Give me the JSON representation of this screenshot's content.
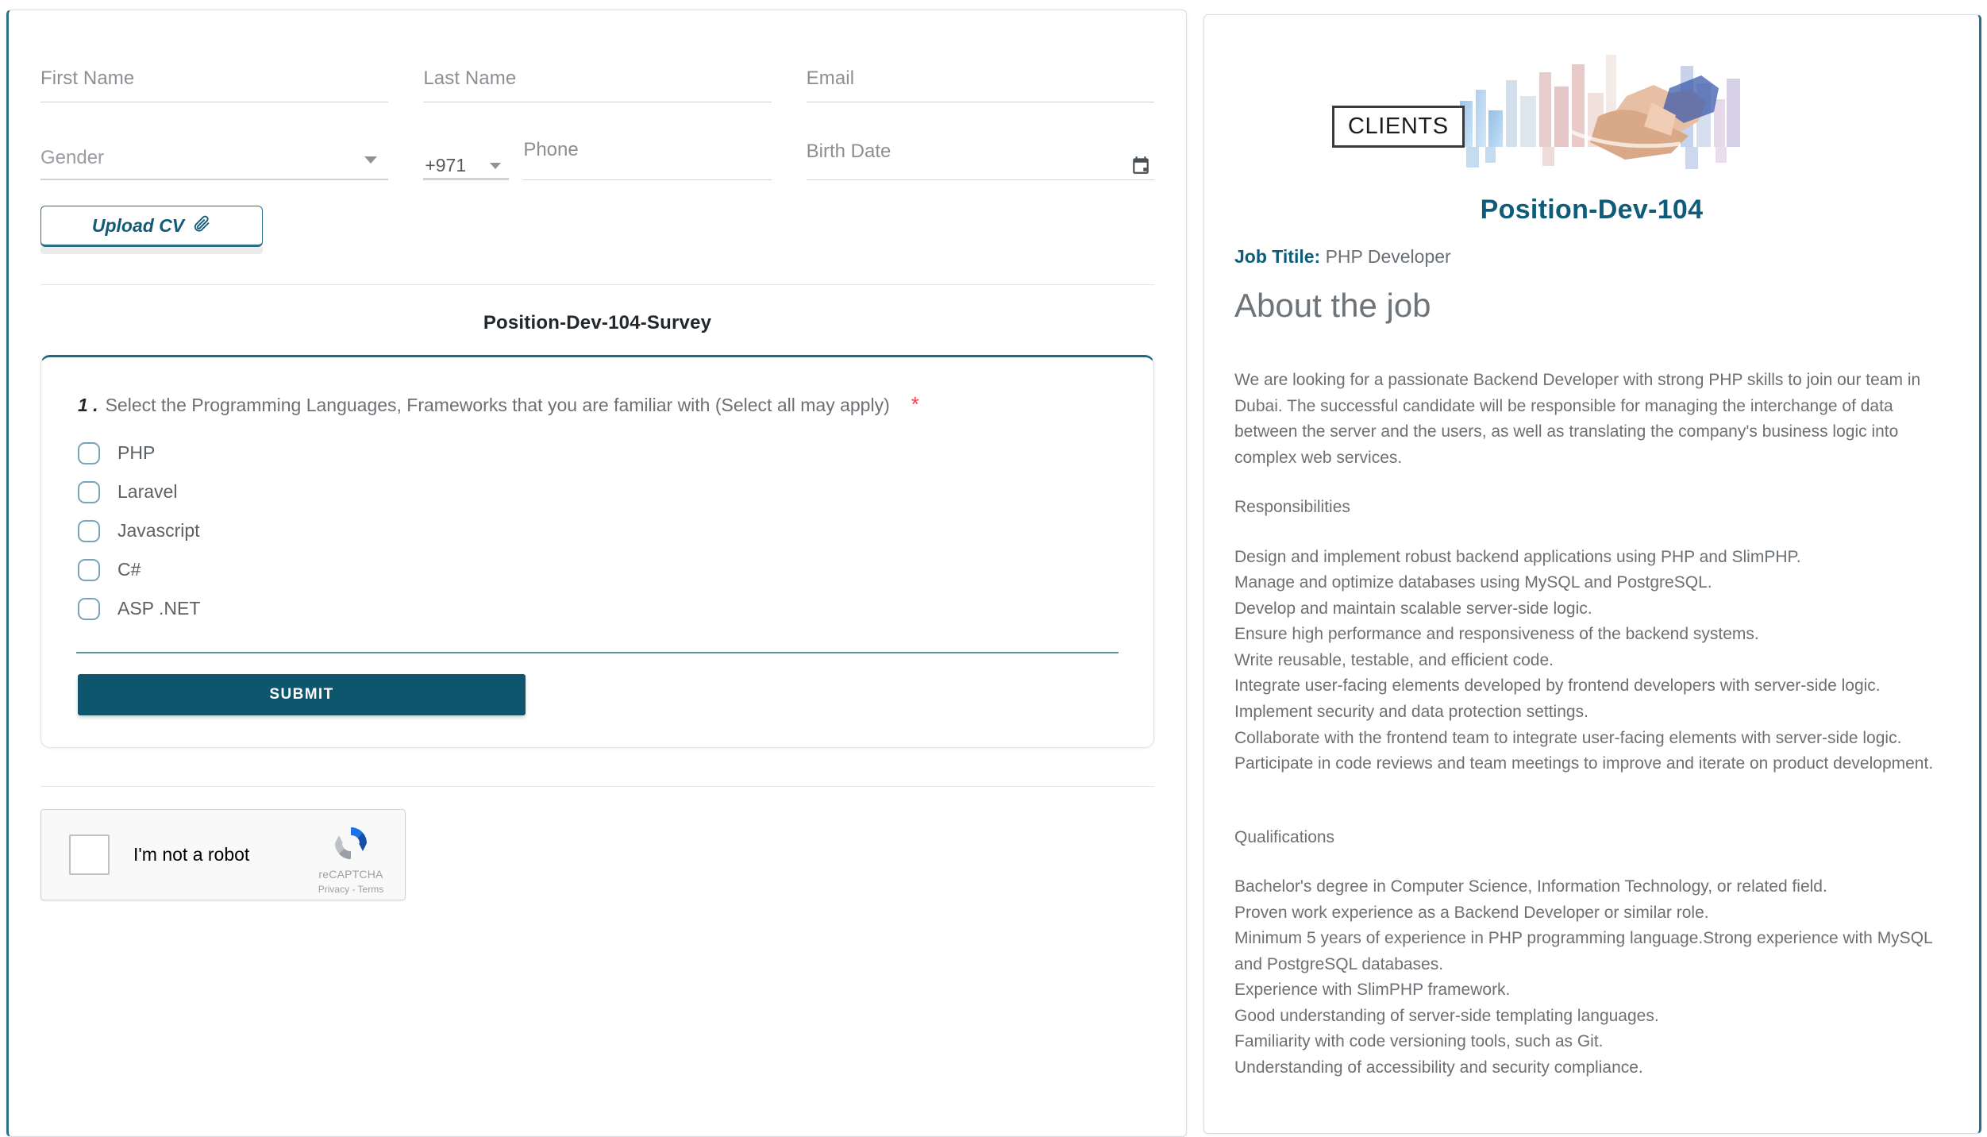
{
  "form": {
    "first_name": {
      "label": "First Name",
      "value": ""
    },
    "last_name": {
      "label": "Last Name",
      "value": ""
    },
    "email": {
      "label": "Email",
      "value": ""
    },
    "gender": {
      "label": "Gender",
      "value": ""
    },
    "country_code": {
      "value": "+971"
    },
    "phone": {
      "label": "Phone",
      "value": ""
    },
    "birth_date": {
      "label": "Birth Date",
      "value": ""
    },
    "upload_cv_label": "Upload CV",
    "upload_icon": "paperclip-icon",
    "calendar_icon": "calendar-icon"
  },
  "survey": {
    "title": "Position-Dev-104-Survey",
    "question_number": "1 .",
    "question_text": "Select the Programming Languages, Frameworks that you are familiar with (Select all may apply)",
    "required_marker": "*",
    "options": [
      {
        "label": "PHP"
      },
      {
        "label": "Laravel"
      },
      {
        "label": "Javascript"
      },
      {
        "label": "C#"
      },
      {
        "label": "ASP .NET"
      }
    ],
    "submit_label": "SUBMIT"
  },
  "recaptcha": {
    "checkbox_label": "I'm not a robot",
    "brand": "reCAPTCHA",
    "links": "Privacy - Terms",
    "logo_icon": "recaptcha-logo-icon"
  },
  "job": {
    "badge": "CLIENTS",
    "hero_image_alt": "handshake-cityscape-image",
    "position": "Position-Dev-104",
    "job_title_label": "Job Titile:",
    "job_title_value": "PHP Developer",
    "about_heading": "About the job",
    "intro": "We are looking for a passionate Backend Developer with strong PHP skills to join our team in Dubai. The successful candidate will be responsible for managing the interchange of data between the server and the users, as well as translating the company's business logic into complex web services.",
    "responsibilities_heading": "Responsibilities",
    "responsibilities": [
      "Design and implement robust backend applications using PHP and SlimPHP.",
      "Manage and optimize databases using MySQL and PostgreSQL.",
      "Develop and maintain scalable server-side logic.",
      "Ensure high performance and responsiveness of the backend systems.",
      "Write reusable, testable, and efficient code.",
      "Integrate user-facing elements developed by frontend developers with server-side logic.",
      "Implement security and data protection settings.",
      "Collaborate with the frontend team to integrate user-facing elements with server-side logic.",
      "Participate in code reviews and team meetings to improve and iterate on product development."
    ],
    "qualifications_heading": "Qualifications",
    "qualifications": [
      "Bachelor's degree in Computer Science, Information Technology, or related field.",
      "Proven work experience as a Backend Developer or similar role.",
      "Minimum 5 years of experience in PHP programming language.Strong experience with MySQL and PostgreSQL databases.",
      "Experience with SlimPHP framework.",
      "Good understanding of server-side templating languages.",
      "Familiarity with code versioning tools, such as Git.",
      "Understanding of accessibility and security compliance."
    ]
  },
  "colors": {
    "accent": "#0f5c7a",
    "submit_bg": "#0e566e",
    "required": "#ff3b4e"
  }
}
